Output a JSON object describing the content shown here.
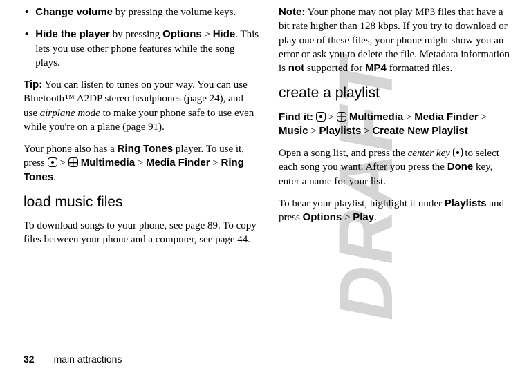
{
  "watermark": "DRAFT",
  "left_col": {
    "bullets": [
      {
        "bold_lead": "Change volume",
        "rest": " by pressing the volume keys."
      }
    ],
    "hide_player": {
      "bold_lead": "Hide the player",
      "mid": " by pressing ",
      "opt": "Options",
      "gt": " > ",
      "hide": "Hide",
      "tail": ". This lets you use other phone features while the song plays."
    },
    "tip": {
      "label": "Tip:",
      "before_italic": " You can listen to tunes on your way. You can use Bluetooth™ A2DP stereo headphones (page 24), and use ",
      "italic": "airplane mode",
      "after_italic": " to make your phone safe to use even while you're on a plane (page 91)."
    },
    "ringtones": {
      "p1": "Your phone also has a ",
      "rt1": "Ring Tones",
      "p2": " player. To use it, press ",
      "gt1": " > ",
      "mm": " Multimedia",
      "gt2": " > ",
      "mf": "Media Finder",
      "gt3": " > ",
      "rt2": "Ring Tones",
      "period": "."
    },
    "h_load": "load music files",
    "load_p": "To download songs to your phone, see page 89. To copy files between your phone and a computer, see page 44."
  },
  "right_col": {
    "note": {
      "label": "Note:",
      "p1": " Your phone may not play MP3 files that have a bit rate higher than 128 kbps. If you try to download or play one of these files, your phone might show you an error or ask you to delete the file. Metadata information is ",
      "not": "not",
      "p2": " supported for ",
      "mp4": "MP4",
      "p3": " formatted files."
    },
    "h_create": "create a playlist",
    "findit": {
      "label": "Find it:",
      "gt": " > ",
      "mm": " Multimedia",
      "mf": "Media Finder",
      "music": "Music",
      "playlists": "Playlists",
      "cnp": "Create New Playlist"
    },
    "open": {
      "p1": "Open a song list, and press the ",
      "ck": "center key",
      "p2": " to select each song you want. After you press the ",
      "done": "Done",
      "p3": " key, enter a name for your list."
    },
    "hear": {
      "p1": "To hear your playlist, highlight it under ",
      "pl": "Playlists",
      "p2": " and press ",
      "opt": "Options",
      "gt": " > ",
      "play": "Play",
      "period": "."
    }
  },
  "footer": {
    "page": "32",
    "section": "main attractions"
  }
}
